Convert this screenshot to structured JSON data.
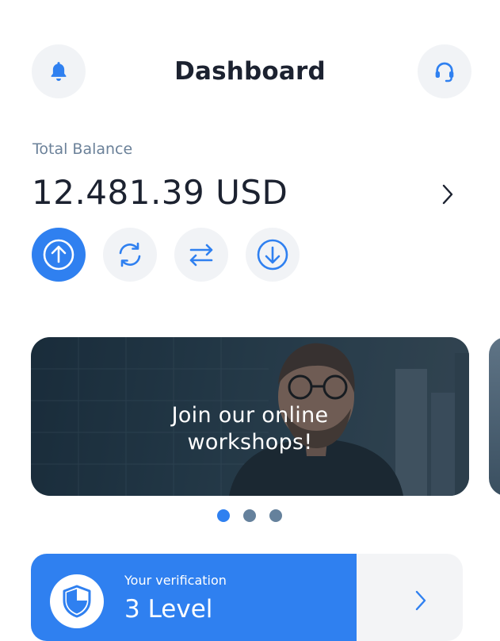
{
  "header": {
    "title": "Dashboard",
    "left_icon": "bell-icon",
    "right_icon": "headset-icon"
  },
  "balance": {
    "label": "Total Balance",
    "amount": "12.481.39 USD",
    "details_icon": "chevron-right-icon"
  },
  "actions": [
    {
      "icon": "arrow-up-circle-icon",
      "active": true
    },
    {
      "icon": "refresh-icon",
      "active": false
    },
    {
      "icon": "transfer-icon",
      "active": false
    },
    {
      "icon": "arrow-down-circle-icon",
      "active": false
    }
  ],
  "banner": {
    "text": "Join our online workshops!"
  },
  "carousel": {
    "dots": 3,
    "active_index": 0
  },
  "verification": {
    "label": "Your verification",
    "level": "3 Level",
    "icon": "shield-icon"
  },
  "colors": {
    "accent": "#2f80f0",
    "icon_bg": "#f1f3f6",
    "muted_text": "#6b8199",
    "dot_inactive": "#65819c"
  }
}
